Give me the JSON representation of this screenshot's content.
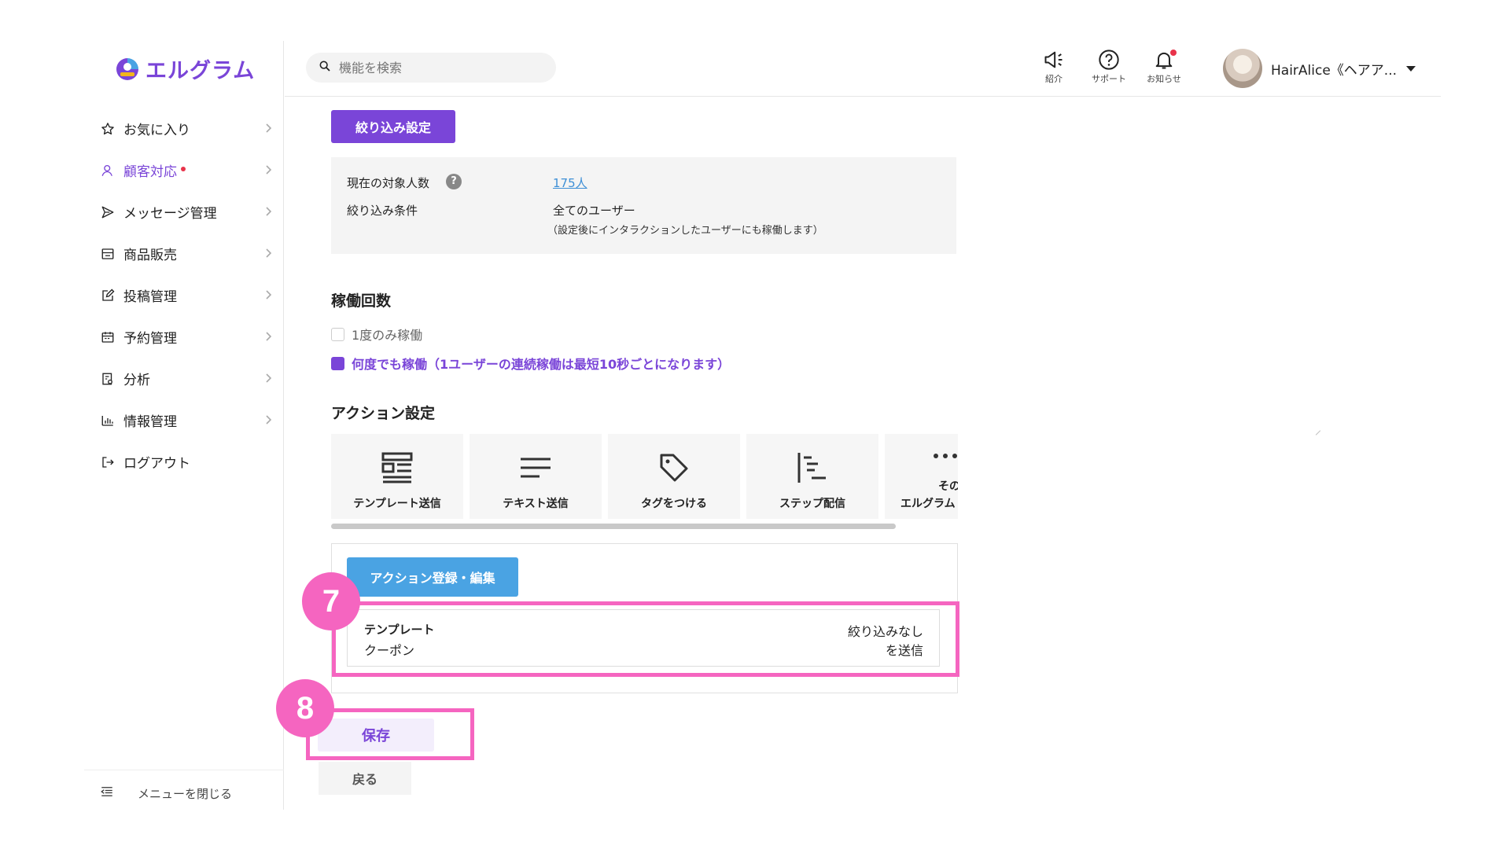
{
  "app": {
    "name": "エルグラム",
    "brand_color": "#7a45d8"
  },
  "sidebar": {
    "items": [
      {
        "label": "お気に入り",
        "icon": "star-icon"
      },
      {
        "label": "顧客対応",
        "icon": "user-icon",
        "active": true,
        "badge_dot": true
      },
      {
        "label": "メッセージ管理",
        "icon": "send-icon"
      },
      {
        "label": "商品販売",
        "icon": "store-icon"
      },
      {
        "label": "投稿管理",
        "icon": "edit-icon"
      },
      {
        "label": "予約管理",
        "icon": "calendar-icon"
      },
      {
        "label": "分析",
        "icon": "report-icon"
      },
      {
        "label": "情報管理",
        "icon": "bar-chart-icon"
      },
      {
        "label": "ログアウト",
        "icon": "logout-icon"
      }
    ],
    "close_menu_label": "メニューを閉じる"
  },
  "header": {
    "search_placeholder": "機能を検索",
    "buttons": [
      {
        "label": "紹介",
        "icon": "megaphone-icon"
      },
      {
        "label": "サポート",
        "icon": "help-circle-icon"
      },
      {
        "label": "お知らせ",
        "icon": "bell-icon",
        "has_dot": true
      }
    ],
    "user_name": "HairAlice《ヘアア..."
  },
  "filter": {
    "button_label": "絞り込み設定",
    "target_count_label": "現在の対象人数",
    "target_count_value": "175人",
    "condition_label": "絞り込み条件",
    "condition_value": "全てのユーザー",
    "condition_note": "（設定後にインタラクションしたユーザーにも稼働します）"
  },
  "frequency": {
    "title": "稼働回数",
    "options": [
      {
        "label": "1度のみ稼働",
        "checked": false
      },
      {
        "label": "何度でも稼働（1ユーザーの連続稼働は最短10秒ごとになります）",
        "checked": true
      }
    ]
  },
  "actions": {
    "title": "アクション設定",
    "cards": [
      {
        "label": "テンプレート送信",
        "icon": "template-icon"
      },
      {
        "label": "テキスト送信",
        "icon": "text-lines-icon"
      },
      {
        "label": "タグをつける",
        "icon": "tag-icon"
      },
      {
        "label": "ステップ配信",
        "icon": "step-icon"
      },
      {
        "label": "その他",
        "label_line2": "エルグラム…",
        "icon": "more-icon"
      }
    ],
    "card5_line1": "その",
    "card5_line2": "エルグラム"
  },
  "action_panel": {
    "button_label": "アクション登録・編集",
    "entry": {
      "kind": "テンプレート",
      "name": "クーポン",
      "right_line1": "絞り込みなし",
      "right_line2": "を送信"
    }
  },
  "footer_buttons": {
    "save": "保存",
    "back": "戻る"
  },
  "annotations": {
    "badge7": "7",
    "badge8": "8",
    "highlight_color": "#f565c0"
  }
}
